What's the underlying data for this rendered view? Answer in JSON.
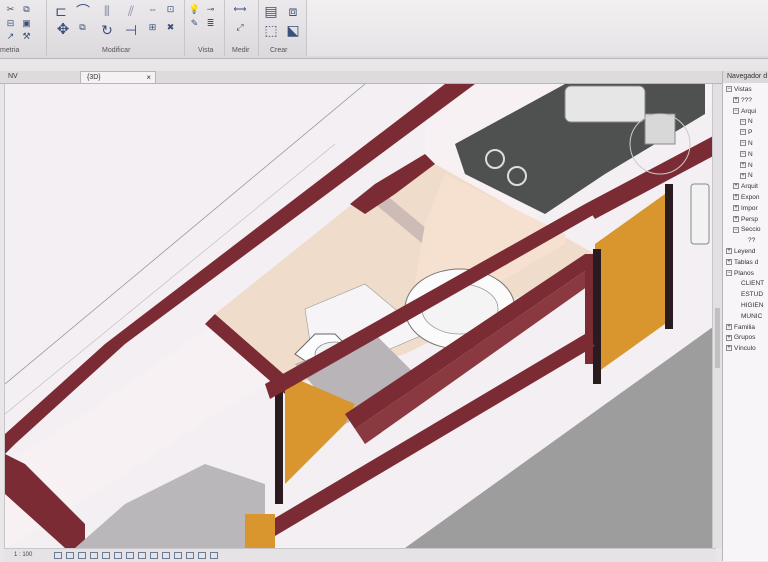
{
  "ribbon": {
    "left_label": "metria",
    "groups": [
      "Modificar",
      "Vista",
      "Medir",
      "Crear"
    ]
  },
  "tabs": [
    {
      "label": "NV"
    },
    {
      "label": "{3D}",
      "close": "×"
    }
  ],
  "status": {
    "scale": "1 : 100"
  },
  "browser": {
    "title": "Navegador d",
    "items": [
      {
        "label": "Vistas",
        "level": 0,
        "toggle": "−"
      },
      {
        "label": "???",
        "level": 1,
        "toggle": "+"
      },
      {
        "label": "Arqui",
        "level": 1,
        "toggle": "−"
      },
      {
        "label": "N",
        "level": 2,
        "toggle": "−"
      },
      {
        "label": "P",
        "level": 2,
        "toggle": "−"
      },
      {
        "label": "N",
        "level": 2,
        "toggle": "−"
      },
      {
        "label": "N",
        "level": 2,
        "toggle": "−"
      },
      {
        "label": "N",
        "level": 2,
        "toggle": "+"
      },
      {
        "label": "N",
        "level": 2,
        "toggle": "+"
      },
      {
        "label": "Arquit",
        "level": 1,
        "toggle": "+"
      },
      {
        "label": "Expon",
        "level": 1,
        "toggle": "+"
      },
      {
        "label": "Impor",
        "level": 1,
        "toggle": "+"
      },
      {
        "label": "Persp",
        "level": 1,
        "toggle": "+"
      },
      {
        "label": "Seccio",
        "level": 1,
        "toggle": "−"
      },
      {
        "label": "??",
        "level": 2,
        "toggle": ""
      },
      {
        "label": "Leyend",
        "level": 0,
        "toggle": "+"
      },
      {
        "label": "Tablas d",
        "level": 0,
        "toggle": "+"
      },
      {
        "label": "Planos",
        "level": 0,
        "toggle": "−"
      },
      {
        "label": "CLIENT",
        "level": 1,
        "toggle": ""
      },
      {
        "label": "ESTUD",
        "level": 1,
        "toggle": ""
      },
      {
        "label": "HIGIEN",
        "level": 1,
        "toggle": ""
      },
      {
        "label": "MUNIC",
        "level": 1,
        "toggle": ""
      },
      {
        "label": "Familia",
        "level": 0,
        "toggle": "+"
      },
      {
        "label": "Grupos",
        "level": 0,
        "toggle": "+"
      },
      {
        "label": "Vínculo",
        "level": 0,
        "toggle": "+"
      }
    ]
  }
}
